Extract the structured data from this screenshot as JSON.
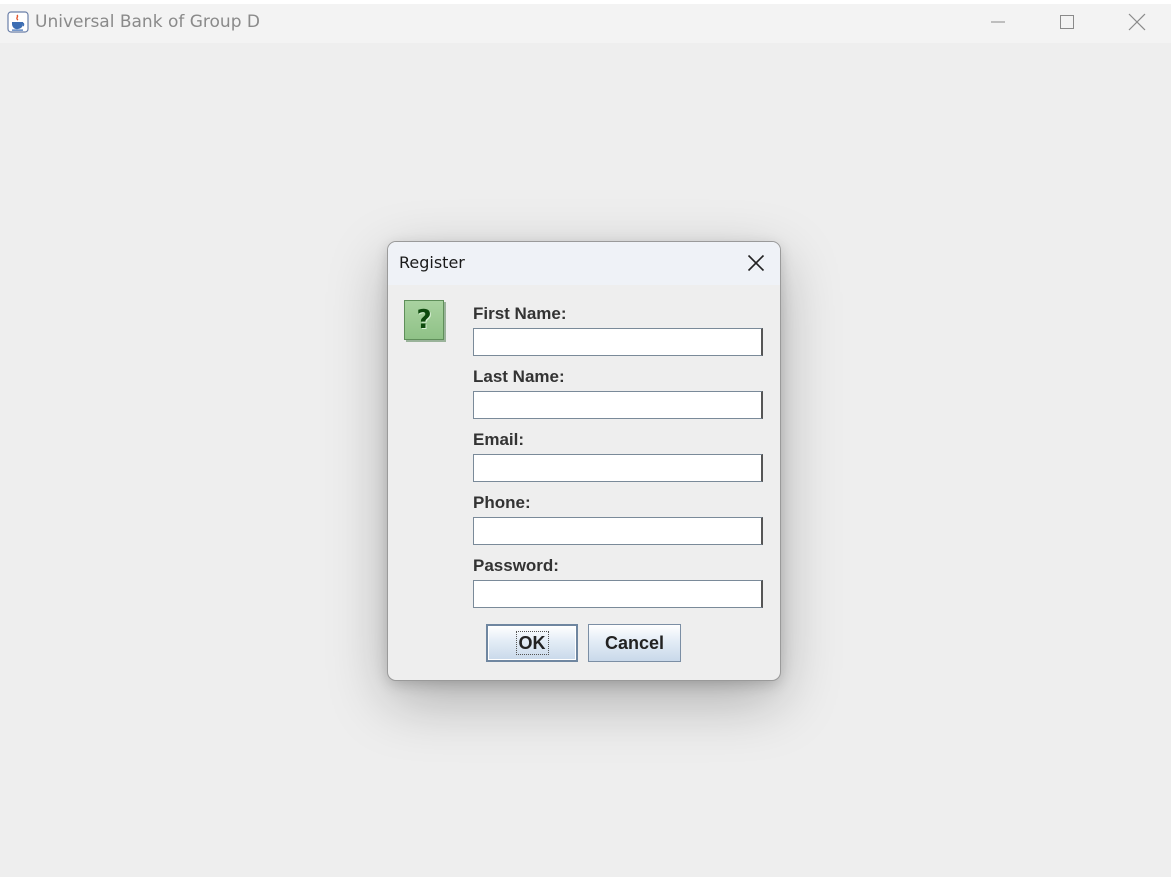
{
  "window": {
    "title": "Universal Bank of Group D",
    "icon": "java-cup-icon",
    "controls": [
      "minimize-icon",
      "maximize-icon",
      "close-icon"
    ]
  },
  "dialog": {
    "title": "Register",
    "icon": "question-icon",
    "icon_glyph": "?",
    "fields": [
      {
        "label": "First Name:",
        "value": ""
      },
      {
        "label": "Last Name:",
        "value": ""
      },
      {
        "label": "Email:",
        "value": ""
      },
      {
        "label": "Phone:",
        "value": ""
      },
      {
        "label": "Password:",
        "value": ""
      }
    ],
    "buttons": {
      "ok": "OK",
      "cancel": "Cancel"
    }
  },
  "colors": {
    "background": "#eeeeee",
    "button_gradient_bottom": "#c9d9ea",
    "icon_green": "#8fc287"
  }
}
